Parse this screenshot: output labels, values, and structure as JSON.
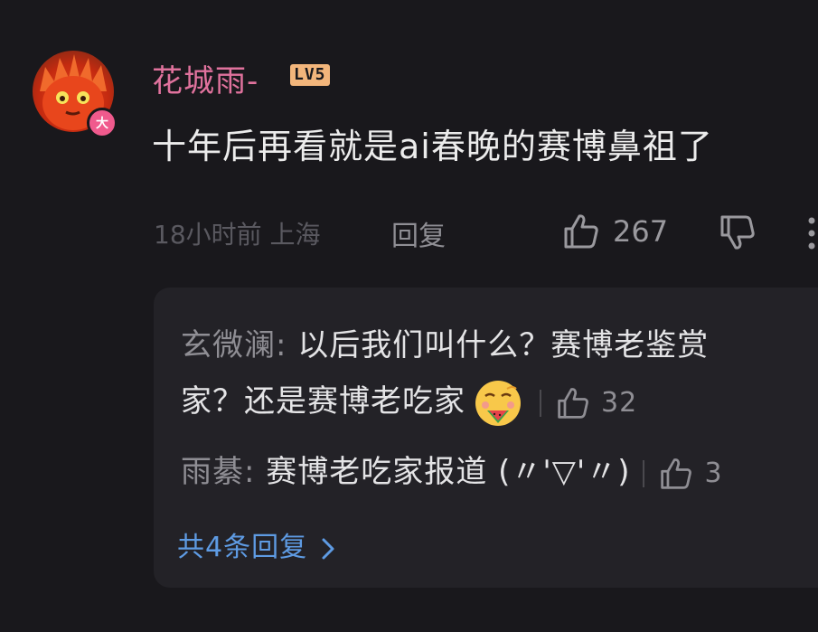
{
  "comment": {
    "username": "花城雨-",
    "level": "LV5",
    "badge": "大",
    "text": "十年后再看就是ai春晚的赛博鼻祖了",
    "time_location": "18小时前 上海",
    "reply_label": "回复",
    "like_count": "267"
  },
  "replies": {
    "items": [
      {
        "name": "玄微澜:",
        "text_line1": " 以后我们叫什么？赛博老鉴赏",
        "text_line2": "家？还是赛博老吃家",
        "like_count": "32"
      },
      {
        "name": "雨綦:",
        "text": " 赛博老吃家报道 (〃'▽'〃)",
        "like_count": "3"
      }
    ],
    "view_all": "共4条回复"
  },
  "colors": {
    "background": "#19181c",
    "username": "#e0729d",
    "link": "#5e9be3",
    "level_badge": "#f2b57b"
  }
}
